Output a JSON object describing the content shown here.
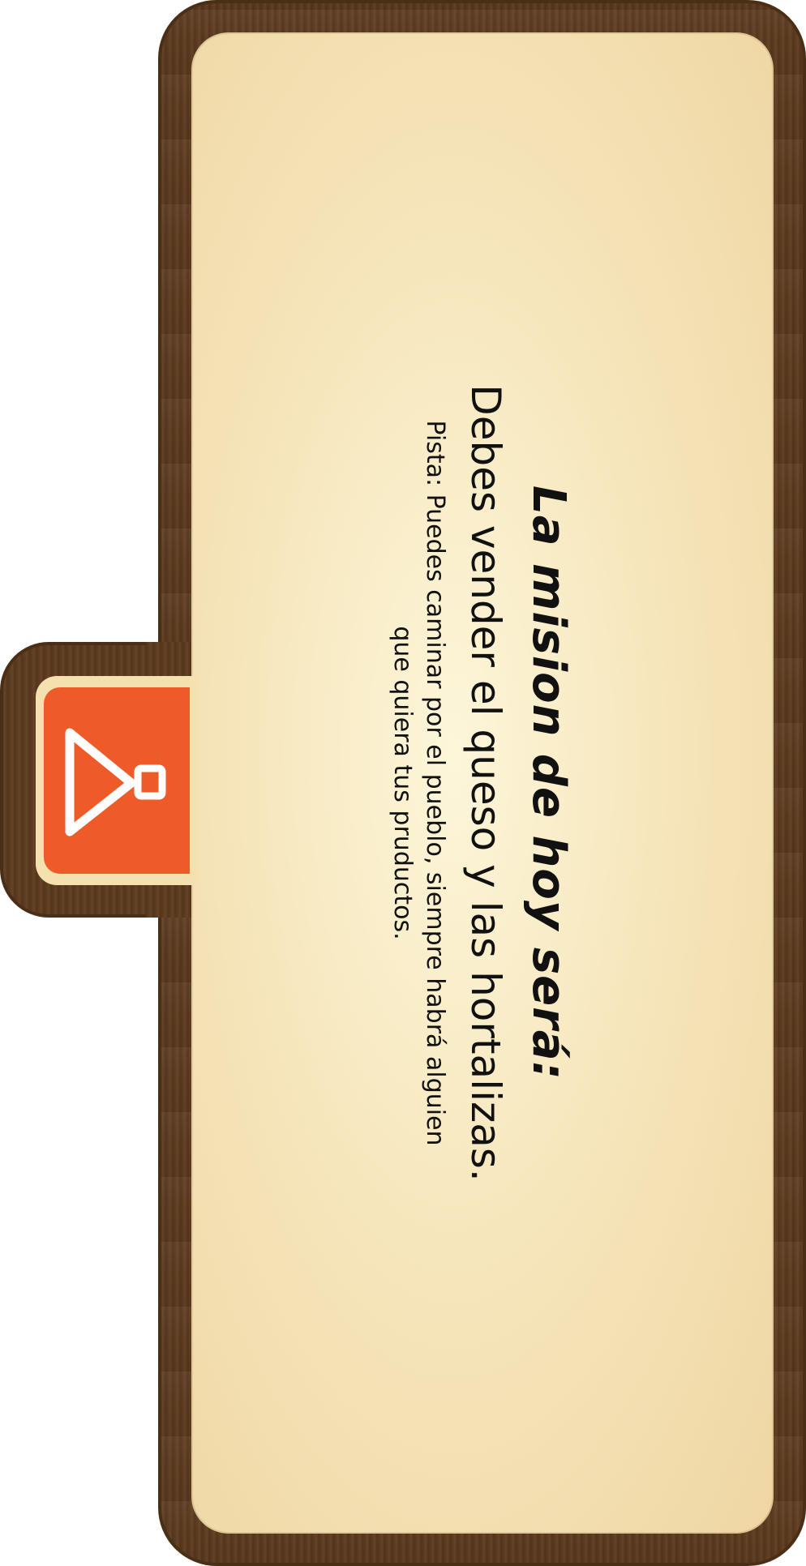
{
  "mission": {
    "title": "La mision de hoy será:",
    "objective": "Debes vender el queso y las hortalizas.",
    "hint": "Pista: Puedes caminar por el pueblo, siempre habrá alguien que quiera tus pruductos."
  },
  "tab": {
    "icon": "map-pin-triangle-icon"
  },
  "colors": {
    "wood": "#5c3a1e",
    "parchment": "#f6e6bc",
    "tab_accent": "#ef5a29"
  }
}
